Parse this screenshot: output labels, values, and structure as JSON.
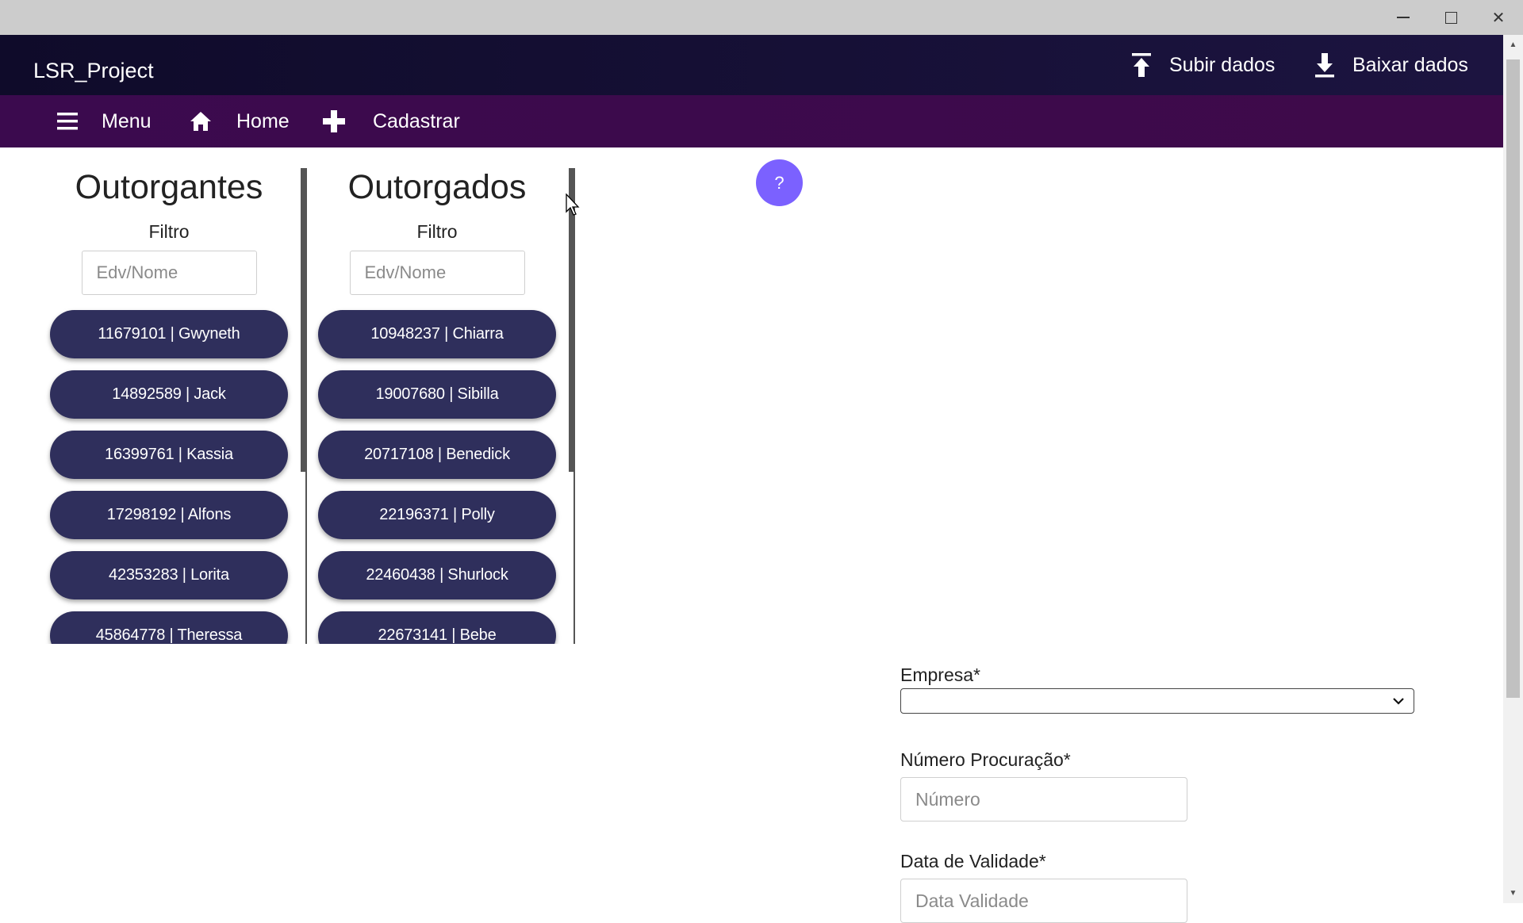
{
  "window": {
    "minimize_icon": "minimize-icon",
    "maximize_icon": "maximize-icon",
    "close_symbol": "✕"
  },
  "header": {
    "app_title": "LSR_Project",
    "upload_label": "Subir dados",
    "download_label": "Baixar dados",
    "bg_color": "#120d30"
  },
  "nav": {
    "menu_label": "Menu",
    "home_label": "Home",
    "register_label": "Cadastrar",
    "bg_color": "#3b0a4e"
  },
  "help": {
    "label": "?",
    "color": "#7b61ff"
  },
  "outorgantes": {
    "title": "Outorgantes",
    "filter_label": "Filtro",
    "filter_placeholder": "Edv/Nome",
    "items": [
      "11679101 | Gwyneth",
      "14892589 | Jack",
      "16399761 | Kassia",
      "17298192 | Alfons",
      "42353283 | Lorita",
      "45864778 | Theressa"
    ]
  },
  "outorgados": {
    "title": "Outorgados",
    "filter_label": "Filtro",
    "filter_placeholder": "Edv/Nome",
    "items": [
      "10948237 | Chiarra",
      "19007680 | Sibilla",
      "20717108 | Benedick",
      "22196371 | Polly",
      "22460438 | Shurlock",
      "22673141 | Bebe"
    ]
  },
  "form": {
    "empresa_label": "Empresa*",
    "empresa_value": "",
    "numero_label": "Número Procuração*",
    "numero_placeholder": "Número",
    "data_label": "Data de Validade*",
    "data_placeholder": "Data Validade"
  },
  "colors": {
    "pill": "#2f2f5c",
    "accent": "#7b61ff"
  }
}
